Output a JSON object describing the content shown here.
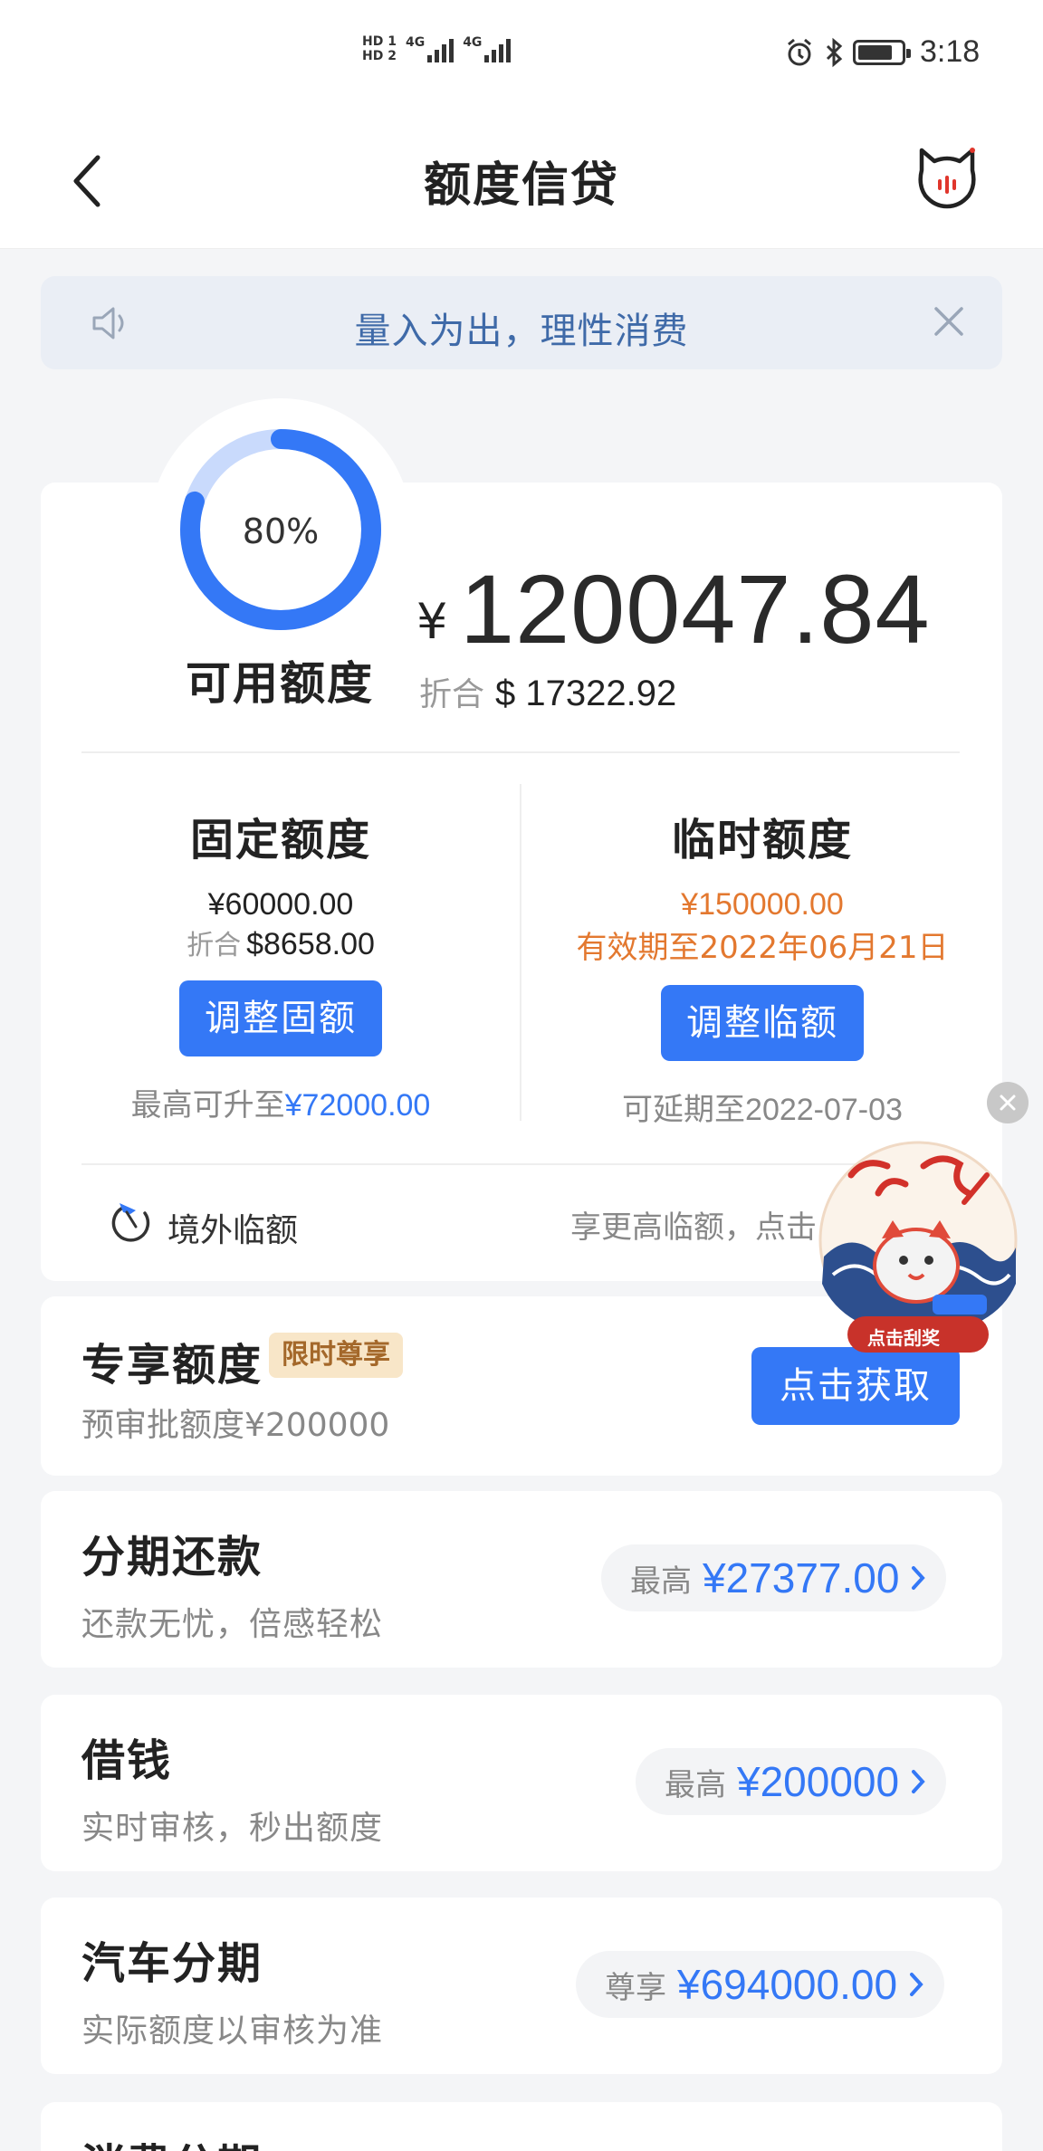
{
  "status_bar": {
    "hd1": "HD 1",
    "hd2": "HD 2",
    "net1": "4G",
    "net2": "4G",
    "time": "3:18"
  },
  "header": {
    "title": "额度信贷"
  },
  "notice": {
    "text": "量入为出，理性消费"
  },
  "credit": {
    "percent_label": "80%",
    "percent_value": 0.8,
    "available_label": "可用额度",
    "currency_symbol": "¥",
    "available_amount": "120047.84",
    "usd_label": "折合",
    "usd_amount": "$ 17322.92",
    "fixed": {
      "title": "固定额度",
      "value": "¥60000.00",
      "usd_label": "折合",
      "usd_value": "$8658.00",
      "button": "调整固额",
      "foot_prefix": "最高可升至",
      "foot_value": "¥72000.00"
    },
    "temp": {
      "title": "临时额度",
      "value": "¥150000.00",
      "validity": "有效期至2022年06月21日",
      "button": "调整临额",
      "foot_prefix": "可延期至",
      "foot_value": "2022-07-03"
    },
    "overseas": {
      "label": "境外临额",
      "promo": "享更高临额，点击"
    }
  },
  "exclusive": {
    "title": "专享额度",
    "badge": "限时尊享",
    "subtitle": "预审批额度¥200000",
    "button": "点击获取"
  },
  "rows": [
    {
      "title": "分期还款",
      "subtitle": "还款无忧，倍感轻松",
      "pill_label": "最高",
      "pill_value": "¥27377.00"
    },
    {
      "title": "借钱",
      "subtitle": "实时审核，秒出额度",
      "pill_label": "最高",
      "pill_value": "¥200000"
    },
    {
      "title": "汽车分期",
      "subtitle": "实际额度以审核为准",
      "pill_label": "尊享",
      "pill_value": "¥694000.00"
    },
    {
      "title": "消费分期"
    }
  ],
  "promo": {
    "label": "点击刮奖"
  },
  "colors": {
    "primary": "#3478f6",
    "orange": "#e3782f",
    "notice_bg": "#eaeef5",
    "notice_text": "#3f6aa8",
    "page_bg": "#f4f5f7"
  }
}
